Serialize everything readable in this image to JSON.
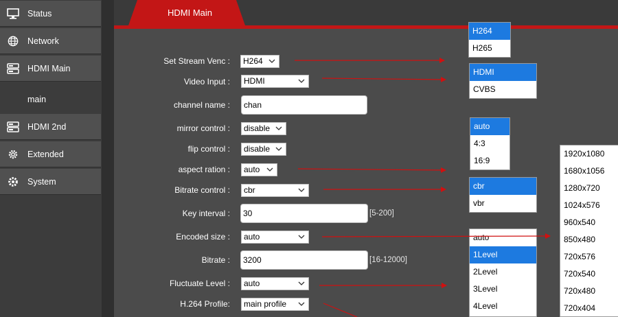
{
  "sidebar": {
    "items": [
      {
        "label": "Status",
        "icon": "monitor-icon"
      },
      {
        "label": "Network",
        "icon": "globe-icon"
      },
      {
        "label": "HDMI Main",
        "icon": "hdmi-device-icon"
      },
      {
        "label": "main"
      },
      {
        "label": "HDMI 2nd",
        "icon": "hdmi-device-icon"
      },
      {
        "label": "Extended",
        "icon": "gear-icon"
      },
      {
        "label": "System",
        "icon": "gear-icon"
      }
    ]
  },
  "tab": {
    "label": "HDMI Main"
  },
  "form": {
    "venc": {
      "label": "Set Stream Venc :",
      "value": "H264"
    },
    "video_input": {
      "label": "Video Input :",
      "value": "HDMI"
    },
    "channel_name": {
      "label": "channel name :",
      "value": "chan"
    },
    "mirror": {
      "label": "mirror control :",
      "value": "disable"
    },
    "flip": {
      "label": "flip control :",
      "value": "disable"
    },
    "aspect": {
      "label": "aspect ration :",
      "value": "auto"
    },
    "bitrate_control": {
      "label": "Bitrate control :",
      "value": "cbr"
    },
    "key_interval": {
      "label": "Key interval :",
      "value": "30",
      "range": "[5-200]"
    },
    "encoded_size": {
      "label": "Encoded size :",
      "value": "auto"
    },
    "bitrate": {
      "label": "Bitrate :",
      "value": "3200",
      "range": "[16-12000]"
    },
    "fluctuate": {
      "label": "Fluctuate Level :",
      "value": "auto"
    },
    "profile": {
      "label": "H.264 Profile:",
      "value": "main profile"
    }
  },
  "popups": {
    "venc_options": [
      "H264",
      "H265"
    ],
    "input_options": [
      "HDMI",
      "CVBS"
    ],
    "aspect_options": [
      "auto",
      "4:3",
      "16:9"
    ],
    "bitrate_options": [
      "cbr",
      "vbr"
    ],
    "fluctuate_options": [
      "auto",
      "1Level",
      "2Level",
      "3Level",
      "4Level"
    ],
    "size_options": [
      "1920x1080",
      "1680x1056",
      "1280x720",
      "1024x576",
      "960x540",
      "850x480",
      "720x576",
      "720x540",
      "720x480",
      "720x404"
    ]
  },
  "colors": {
    "accent_red": "#c31616",
    "highlight_blue": "#1d7ae0"
  }
}
